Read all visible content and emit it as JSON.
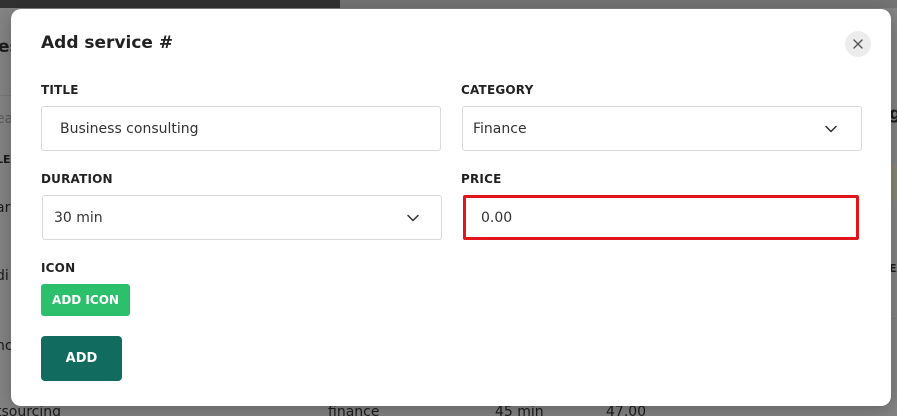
{
  "background": {
    "fragments": [
      "oo",
      "es",
      "ea",
      "LE",
      "ar",
      "di",
      "nc",
      "tsourcing",
      "finance",
      "45 min",
      "47.00",
      "g",
      "EA"
    ]
  },
  "modal": {
    "title": "Add service #",
    "close_icon": "close-icon",
    "title_field": {
      "label": "TITLE",
      "value": "Business consulting"
    },
    "category_field": {
      "label": "CATEGORY",
      "value": "Finance",
      "icon": "chevron-down-icon"
    },
    "duration_field": {
      "label": "DURATION",
      "value": "30 min",
      "icon": "chevron-down-icon"
    },
    "price_field": {
      "label": "PRICE",
      "value": "0.00",
      "highlight_color": "#e0161b"
    },
    "icon_section": {
      "label": "ICON",
      "button_label": "ADD ICON",
      "button_color": "#2cbf6c"
    },
    "submit": {
      "label": "ADD",
      "color": "#126b5f"
    }
  }
}
